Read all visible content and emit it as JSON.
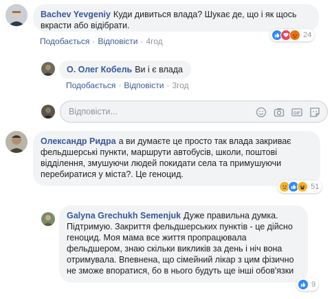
{
  "comments": [
    {
      "author": "Bachev Yevgeniy",
      "text": "Куди дивиться влада? Шукає де, що і як щось вкрасти або відібрати.",
      "like_label": "Подобається",
      "reply_label": "Відповісти",
      "time": "4год",
      "reaction_count": "24"
    },
    {
      "author": "О. Олег Кобель",
      "text": "Ви і є влада",
      "like_label": "Подобається",
      "reply_label": "Відповісти",
      "time": "3год"
    },
    {
      "author": "Олександр Ридра",
      "text": "а ви думаєте це просто так влада закриває фельдшерські пункти, маршрути автобусів, школи, поштові відділення, змушуючи людей покидати села та примушуючи перебиратися у міста?. Це геноцид.",
      "reaction_count": "51"
    },
    {
      "author": "Galyna Grechukh Semenjuk",
      "text": "Дуже правильна думка. Підтримую. Закриття фельдшерських пунктів - це дійсно геноцид. Моя мама все життя пропрацювала фельдшером, знаю скільки викликів за день і ніч вона отримувала. Впевнена, що сімейний лікар з цим фізично не зможе впоратися, бо в нього будуть ще інші обов'язки",
      "reaction_count": "9"
    }
  ],
  "reply_box": {
    "placeholder": "Відповісти..."
  },
  "icons": {
    "reply_tools": [
      "emoji-icon",
      "camera-icon",
      "gif-icon",
      "sticker-icon"
    ],
    "reactions": [
      "like-icon",
      "love-icon",
      "angry-icon",
      "sad-icon",
      "haha-icon"
    ]
  },
  "colors": {
    "link": "#385898",
    "bubble": "#f2f3f5",
    "meta": "#90949c",
    "like": "#2d88ff",
    "love": "#f33e58",
    "angry": "#e9710f",
    "sad_haha": "#f7b125"
  }
}
